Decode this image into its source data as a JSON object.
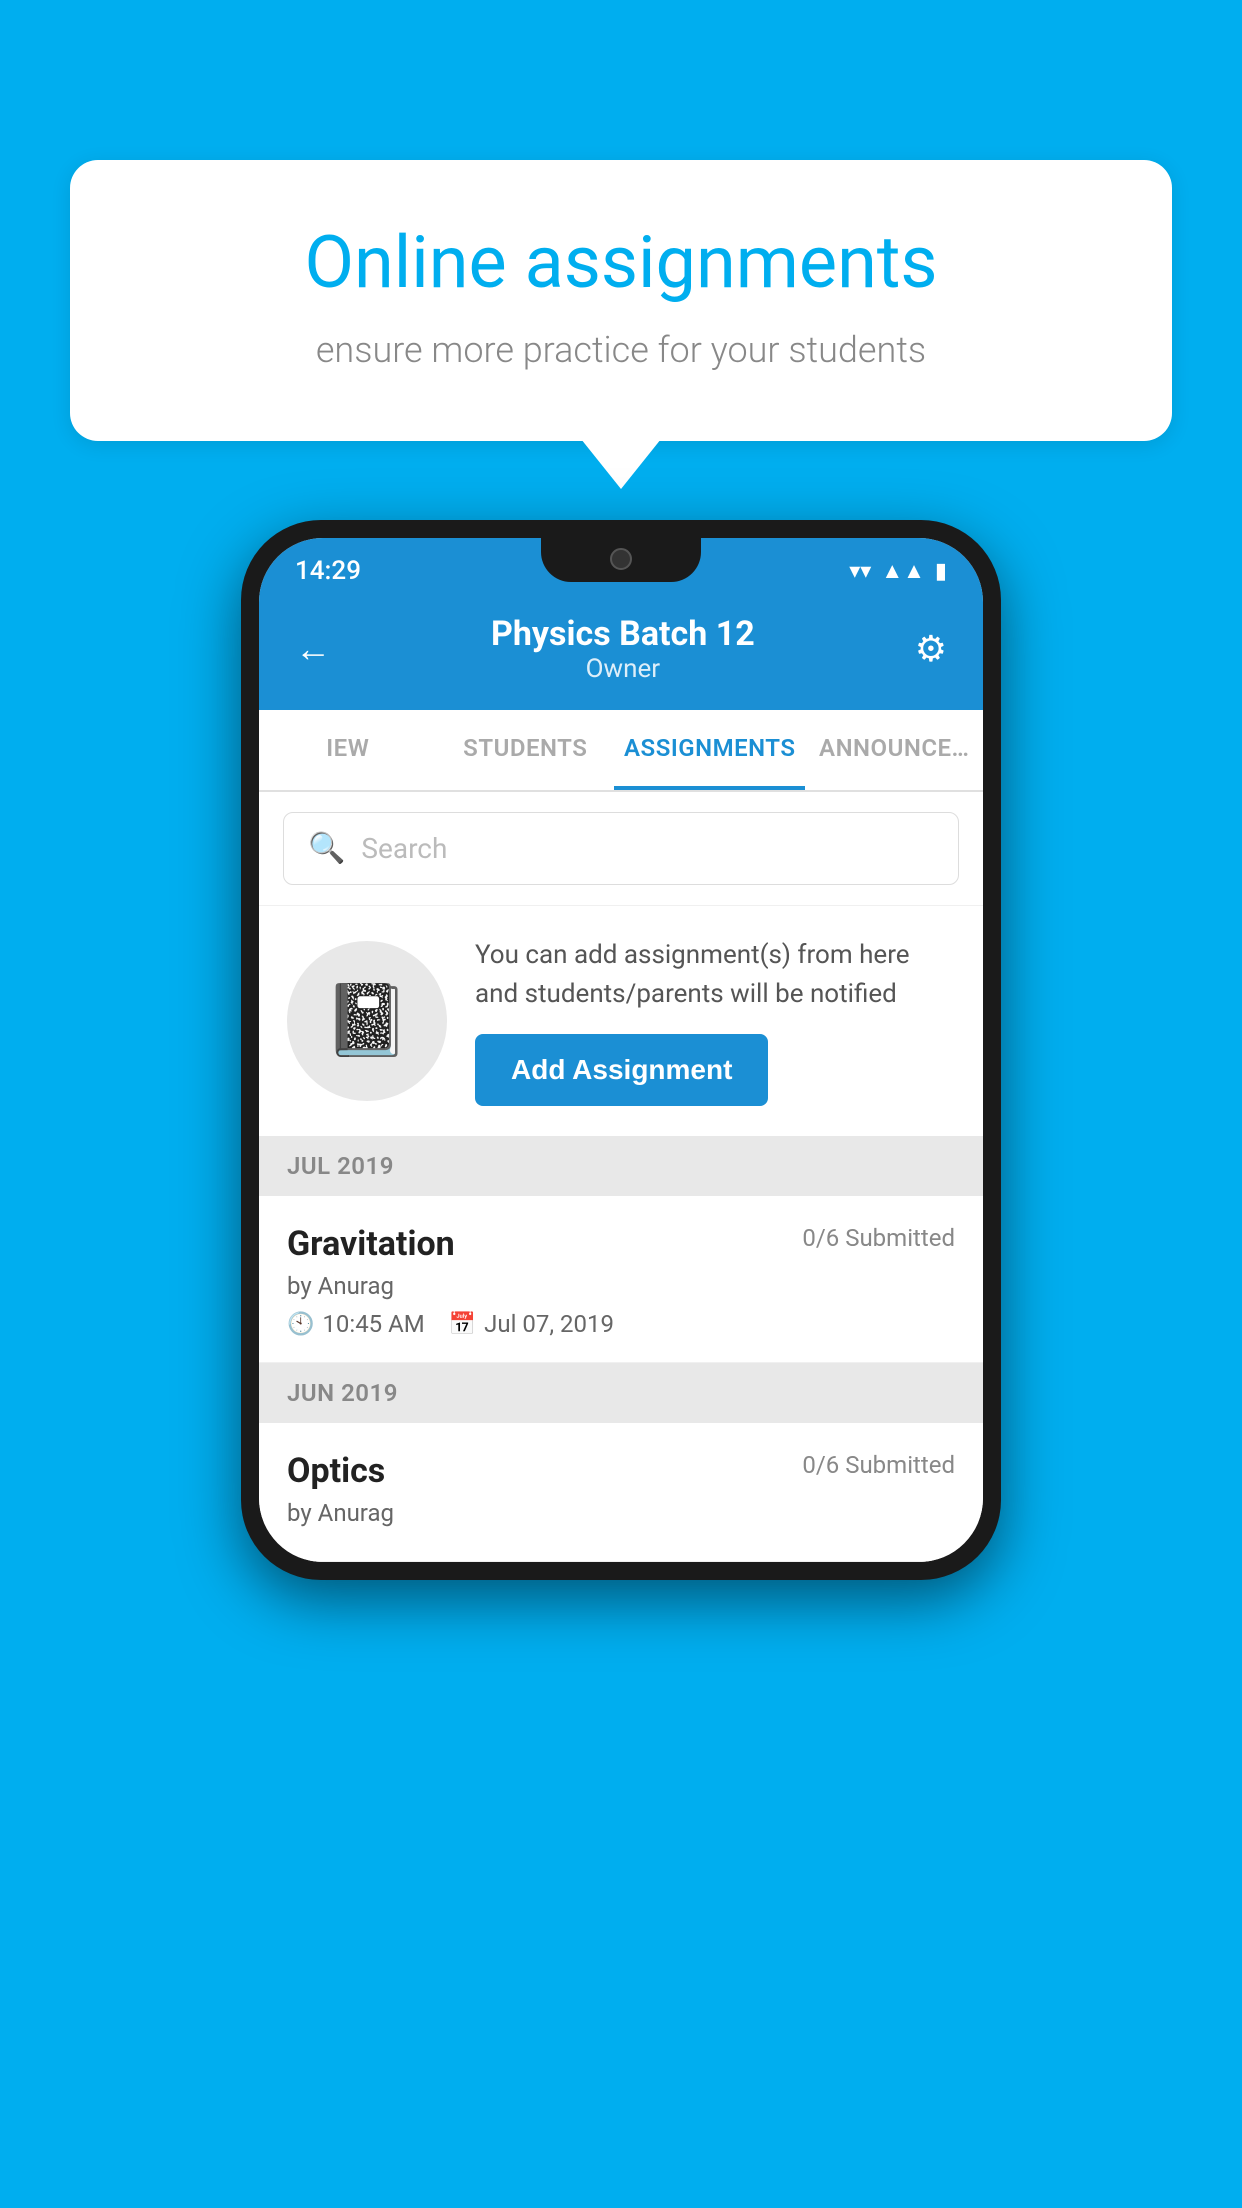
{
  "background_color": "#00AEEF",
  "speech_bubble": {
    "title": "Online assignments",
    "subtitle": "ensure more practice for your students"
  },
  "phone": {
    "status_bar": {
      "time": "14:29",
      "icons": [
        "wifi",
        "signal",
        "battery"
      ]
    },
    "header": {
      "title": "Physics Batch 12",
      "subtitle": "Owner",
      "back_label": "←",
      "settings_label": "⚙"
    },
    "tabs": [
      {
        "label": "IEW",
        "active": false
      },
      {
        "label": "STUDENTS",
        "active": false
      },
      {
        "label": "ASSIGNMENTS",
        "active": true
      },
      {
        "label": "ANNOUNCEMENTS",
        "active": false
      }
    ],
    "search": {
      "placeholder": "Search"
    },
    "promo": {
      "text": "You can add assignment(s) from here and students/parents will be notified",
      "button_label": "Add Assignment"
    },
    "sections": [
      {
        "label": "JUL 2019",
        "assignments": [
          {
            "name": "Gravitation",
            "submitted": "0/6 Submitted",
            "author": "by Anurag",
            "time": "10:45 AM",
            "date": "Jul 07, 2019"
          }
        ]
      },
      {
        "label": "JUN 2019",
        "assignments": [
          {
            "name": "Optics",
            "submitted": "0/6 Submitted",
            "author": "by Anurag",
            "time": "",
            "date": ""
          }
        ]
      }
    ]
  }
}
